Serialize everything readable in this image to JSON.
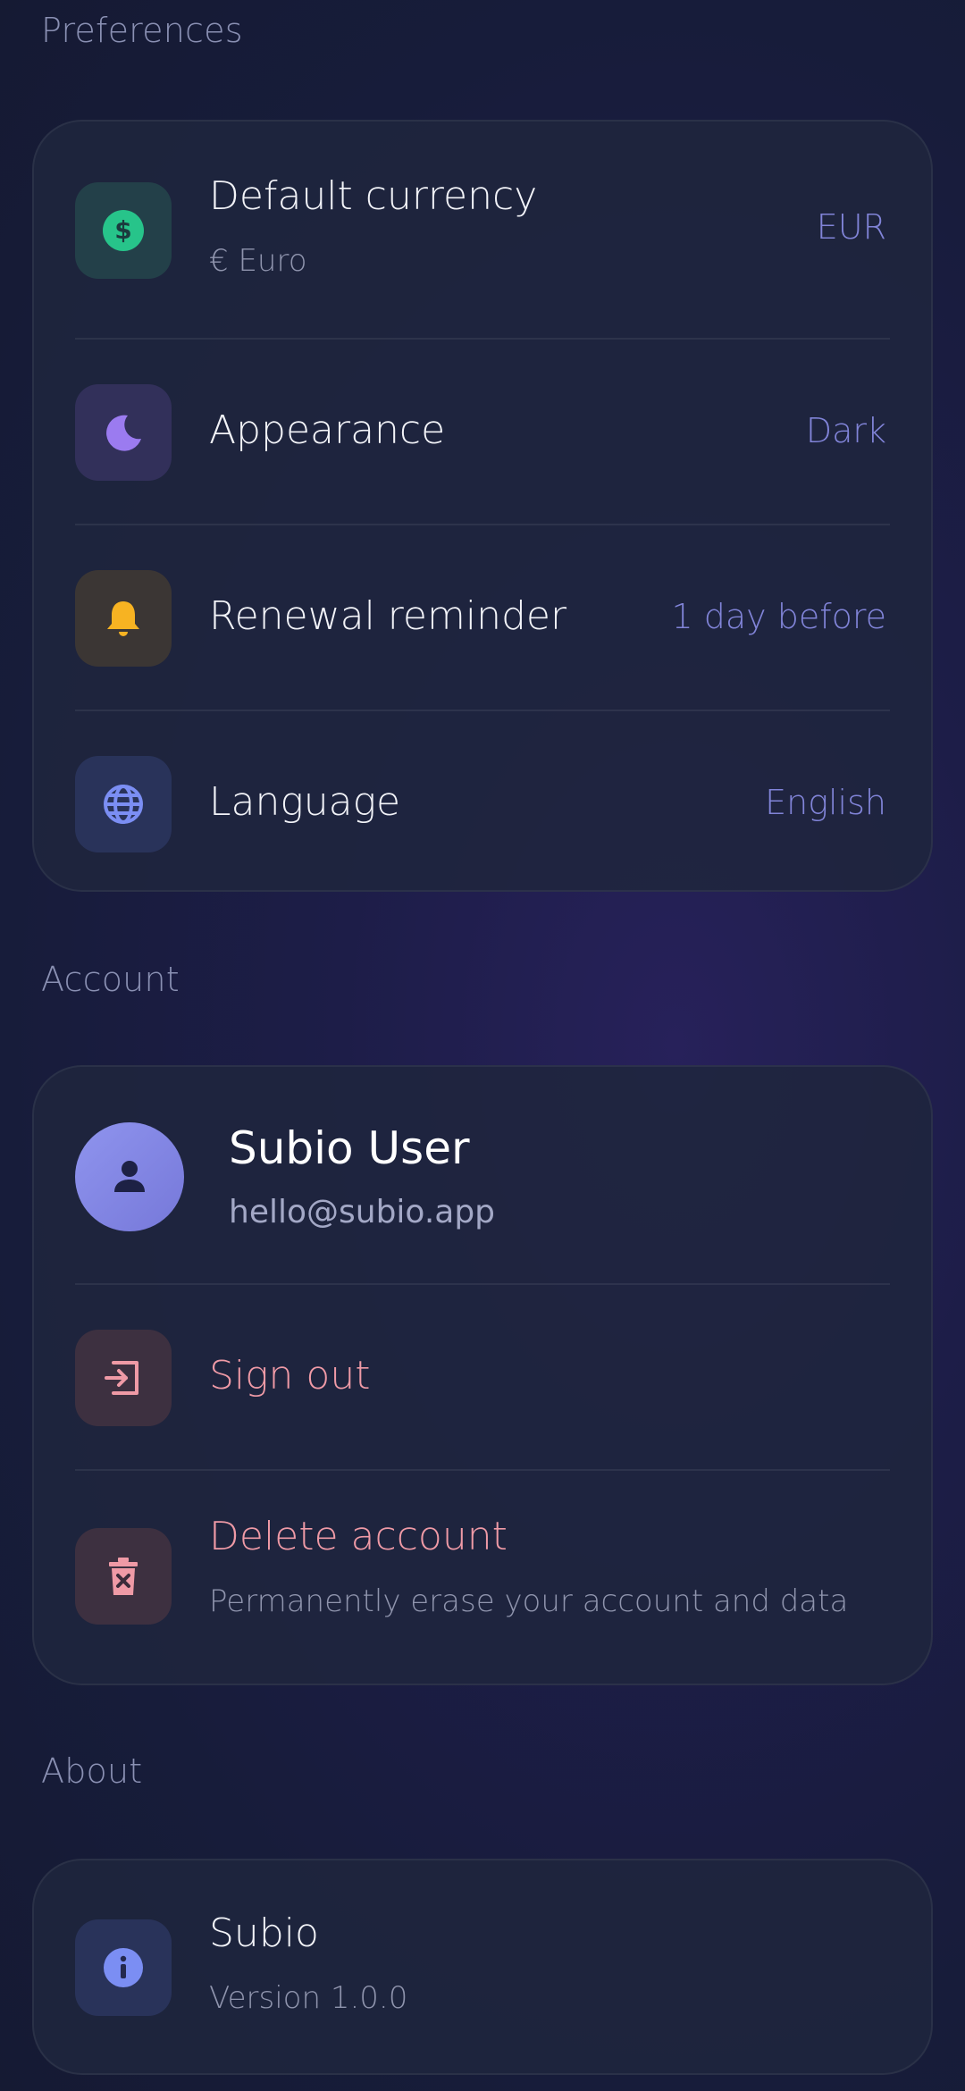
{
  "sections": {
    "preferences_label": "Preferences",
    "account_label": "Account",
    "about_label": "About"
  },
  "preferences": {
    "currency": {
      "title": "Default currency",
      "subtitle": "€ Euro",
      "value": "EUR",
      "icon": "dollar-icon"
    },
    "appearance": {
      "title": "Appearance",
      "value": "Dark",
      "icon": "moon-icon"
    },
    "reminder": {
      "title": "Renewal reminder",
      "value": "1 day before",
      "icon": "bell-icon"
    },
    "language": {
      "title": "Language",
      "value": "English",
      "icon": "globe-icon"
    }
  },
  "account": {
    "user": {
      "name": "Subio User",
      "email": "hello@subio.app",
      "icon": "person-icon"
    },
    "sign_out": {
      "title": "Sign out",
      "icon": "sign-out-icon"
    },
    "delete": {
      "title": "Delete account",
      "subtitle": "Permanently erase your account and data",
      "icon": "trash-icon"
    }
  },
  "about": {
    "app": {
      "title": "Subio",
      "subtitle": "Version 1.0.0",
      "icon": "info-icon"
    }
  },
  "colors": {
    "accent": "#8184d8",
    "danger": "#ef9aa6",
    "green": "#27c48a",
    "purple": "#9b7bf0",
    "amber": "#f7b322",
    "blue": "#7b8ef3"
  }
}
